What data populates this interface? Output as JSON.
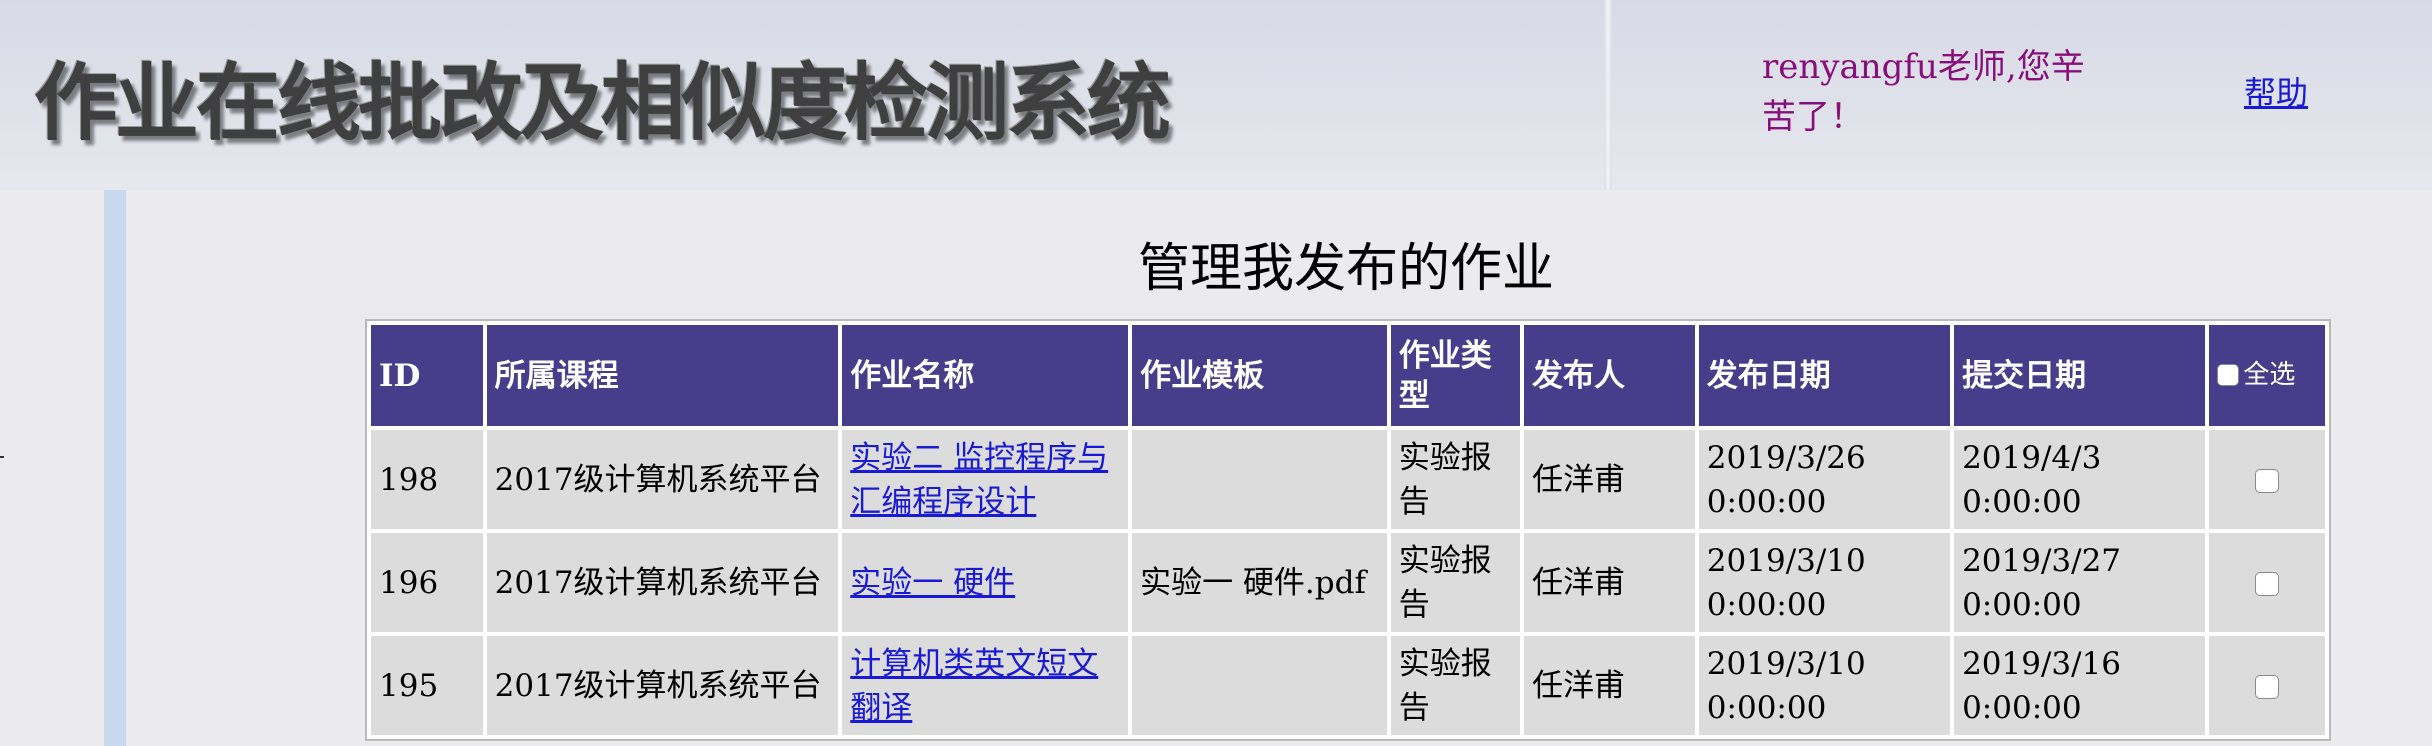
{
  "header": {
    "title": "作业在线批改及相似度检测系统",
    "greeting": "renyangfu老师,您辛苦了！",
    "help_label": "帮助"
  },
  "main": {
    "title": "管理我发布的作业",
    "columns": [
      "ID",
      "所属课程",
      "作业名称",
      "作业模板",
      "作业类型",
      "发布人",
      "发布日期",
      "提交日期"
    ],
    "select_all_label": "全选",
    "rows": [
      {
        "id": "198",
        "course": "2017级计算机系统平台",
        "name": "实验二 监控程序与汇编程序设计",
        "template": "",
        "type": "实验报告",
        "publisher": "任洋甫",
        "publish_date": "2019/3/26 0:00:00",
        "submit_date": "2019/4/3 0:00:00"
      },
      {
        "id": "196",
        "course": "2017级计算机系统平台",
        "name": "实验一 硬件",
        "template": "实验一 硬件.pdf",
        "type": "实验报告",
        "publisher": "任洋甫",
        "publish_date": "2019/3/10 0:00:00",
        "submit_date": "2019/3/27 0:00:00"
      },
      {
        "id": "195",
        "course": "2017级计算机系统平台",
        "name": "计算机类英文短文翻译",
        "template": "",
        "type": "实验报告",
        "publisher": "任洋甫",
        "publish_date": "2019/3/10 0:00:00",
        "submit_date": "2019/3/16 0:00:00"
      }
    ]
  },
  "colors": {
    "header_bg": "#483d8b",
    "cell_bg": "#dcdcdc",
    "link": "#1a1ad4",
    "greeting": "#880e7a"
  }
}
